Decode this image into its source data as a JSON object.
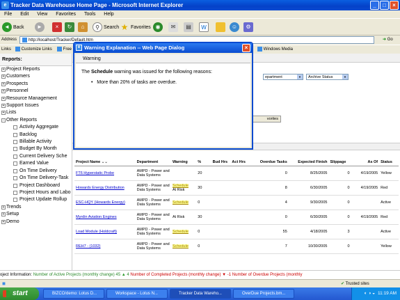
{
  "window": {
    "title": "Tracker Data Warehouse Home Page - Microsoft Internet Explorer"
  },
  "menu": [
    "File",
    "Edit",
    "View",
    "Favorites",
    "Tools",
    "Help"
  ],
  "toolbar": {
    "back": "Back",
    "search": "Search",
    "favorites": "Favorites"
  },
  "address": {
    "label": "Address",
    "url": "http://localhost/Tracker/Default.htm",
    "go": "Go"
  },
  "links": {
    "label": "Links",
    "customize": "Customize Links",
    "free": "Free",
    "windows_media": "Windows Media"
  },
  "sidebar": {
    "header": "Reports:",
    "items": [
      {
        "label": "Project Reports",
        "level": 1,
        "expander": "+"
      },
      {
        "label": "Customers",
        "level": 1,
        "expander": "+"
      },
      {
        "label": "Prospects",
        "level": 1,
        "expander": "+"
      },
      {
        "label": "Personnel",
        "level": 1,
        "expander": "+"
      },
      {
        "label": "Resource Management",
        "level": 1,
        "expander": "+"
      },
      {
        "label": "Support Issues",
        "level": 1,
        "expander": "+"
      },
      {
        "label": "Lists",
        "level": 1,
        "expander": "+"
      },
      {
        "label": "Other Reports",
        "level": 1,
        "expander": "-"
      },
      {
        "label": "Activity Aggregate",
        "level": 2
      },
      {
        "label": "Backlog",
        "level": 2
      },
      {
        "label": "Billable Activity",
        "level": 2
      },
      {
        "label": "Budget By Month",
        "level": 2
      },
      {
        "label": "Current Delivery Sche",
        "level": 2
      },
      {
        "label": "Earned Value",
        "level": 2
      },
      {
        "label": "On Time Delivery",
        "level": 2
      },
      {
        "label": "On Time Delivery-Task",
        "level": 2
      },
      {
        "label": "Project Dashboard",
        "level": 2
      },
      {
        "label": "Project Hours and Labo",
        "level": 2
      },
      {
        "label": "Project Update Rollup",
        "level": 2
      },
      {
        "label": "Trends",
        "level": 1,
        "expander": "+"
      },
      {
        "label": "Setup",
        "level": 1,
        "expander": "+"
      },
      {
        "label": "Demo",
        "level": 1,
        "expander": "+"
      }
    ]
  },
  "filters": {
    "department_value": "epartment",
    "archive_status": "Archive Status",
    "favorites_button": "vorites"
  },
  "dialog": {
    "title": "Warning Explanation -- Web Page Dialog",
    "tab": "Warning",
    "msg_prefix": "The ",
    "msg_bold": "Schedule",
    "msg_suffix": " warning was issued for the following reasons:",
    "bullet": "More than 20% of tasks are overdue."
  },
  "table": {
    "columns": [
      "Project Name",
      "Department",
      "Warning",
      "%",
      "Bud Hrs",
      "Act Hrs",
      "Overdue Tasks",
      "Expected Finish",
      "Slippage",
      "As Of",
      "Status"
    ],
    "rows": [
      {
        "name": "FT6 Hyperstatic Probe",
        "dept": "AMPD - Power and Data Systems",
        "warning": "",
        "warning2": "",
        "pct": "20",
        "bud": "",
        "act": "",
        "overdue": "0",
        "finish": "8/25/2005",
        "slip": "0",
        "asof": "4/19/2005",
        "status": "Yellow"
      },
      {
        "name": "Howards Energy Distribution",
        "dept": "AMPD - Power and Data Systems",
        "warning": "Schedule",
        "warning2": "At Risk",
        "pct": "30",
        "bud": "",
        "act": "",
        "overdue": "8",
        "finish": "6/30/2005",
        "slip": "0",
        "asof": "4/19/2005",
        "status": "Red"
      },
      {
        "name": "ESC-HQY (Howards Energy)",
        "dept": "AMPD - Power and Data Systems",
        "warning": "Schedule",
        "warning2": "",
        "pct": "0",
        "bud": "",
        "act": "",
        "overdue": "4",
        "finish": "9/30/2005",
        "slip": "0",
        "asof": "",
        "status": "Active"
      },
      {
        "name": "Myrdin Aviation Engines",
        "dept": "AMPD - Power and Data Systems",
        "warning": "",
        "warning2": "At Risk",
        "pct": "30",
        "bud": "",
        "act": "",
        "overdue": "0",
        "finish": "6/30/2005",
        "slip": "0",
        "asof": "4/19/2005",
        "status": "Red"
      },
      {
        "name": "Load Module (Holdcraft)",
        "dept": "AMPD - Power and Data Systems",
        "warning": "Schedule",
        "warning2": "",
        "pct": "0",
        "bud": "",
        "act": "",
        "overdue": "55",
        "finish": "4/18/2005",
        "slip": "3",
        "asof": "",
        "status": "Active"
      },
      {
        "name": "REH7 - (1032)",
        "dept": "AMPD - Power and Data Systems",
        "warning": "Schedule",
        "warning2": "",
        "pct": "0",
        "bud": "",
        "act": "",
        "overdue": "7",
        "finish": "10/30/2005",
        "slip": "0",
        "asof": "",
        "status": "Yellow"
      }
    ]
  },
  "project_info": {
    "label": "oject Information:",
    "active": "Number of Active Projects (monthly change) 45",
    "active_delta": "4",
    "completed": "Number of Completed Projects (monthly change)",
    "completed_delta": "-1",
    "overdue": "Number of Overdue Projects (monthly"
  },
  "iestatus": {
    "zone": "Trusted sites"
  },
  "taskbar": {
    "start": "start",
    "tasks": [
      "BIZCO/demo: Lotus D...",
      "Workspace - Lotus N...",
      "Tracker Data Wareho...",
      "OverDue Projects.bm..."
    ],
    "clock": "11:19 AM"
  },
  "colors": {
    "xp_blue": "#0a4bd0",
    "start_green": "#3a9a3a",
    "link_blue": "#0000cc",
    "warning_highlight": "#ffff99"
  }
}
